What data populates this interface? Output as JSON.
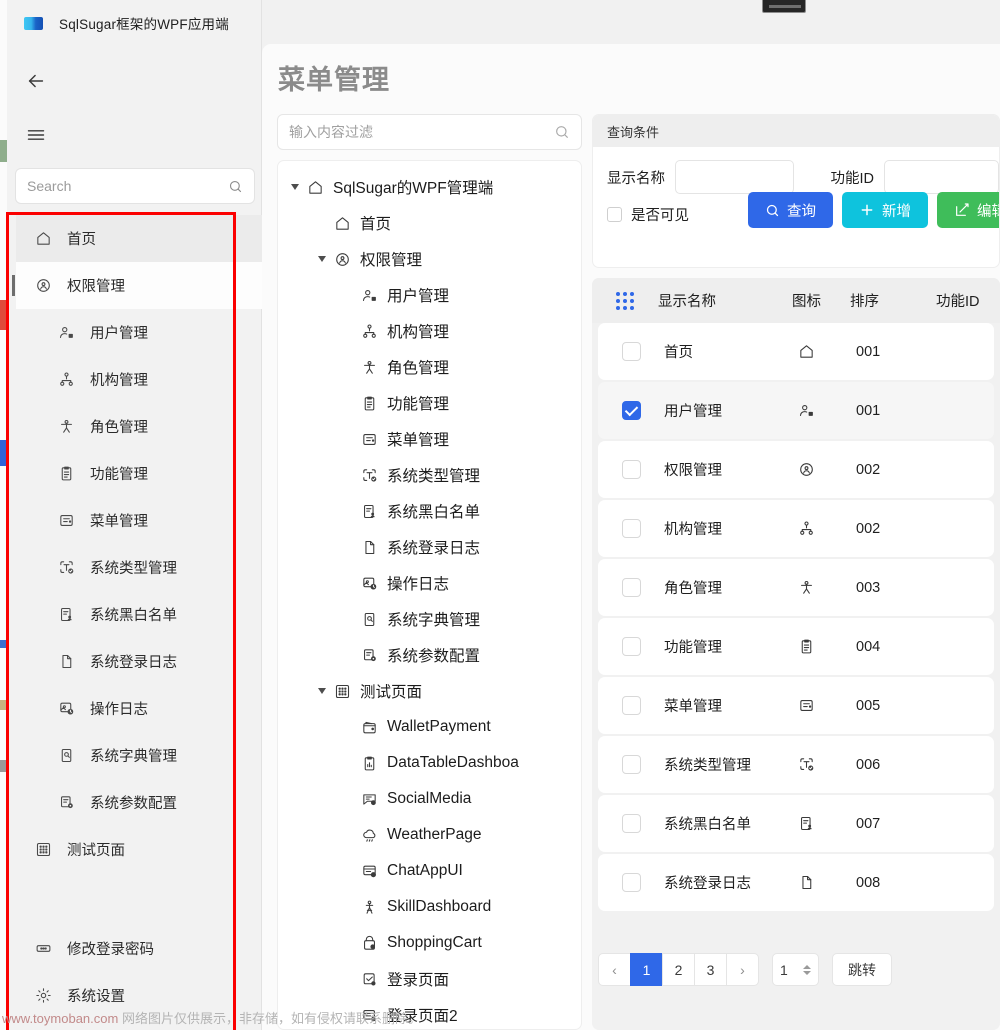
{
  "window": {
    "app_title": "SqlSugar框架的WPF应用端"
  },
  "sidebar": {
    "search_placeholder": "Search",
    "items": [
      {
        "label": "首页",
        "icon": "home-icon",
        "level": 1,
        "state": "hover"
      },
      {
        "label": "权限管理",
        "icon": "shield-user-icon",
        "level": 1,
        "state": "selected"
      },
      {
        "label": "用户管理",
        "icon": "user-settings-icon",
        "level": 2,
        "state": ""
      },
      {
        "label": "机构管理",
        "icon": "org-tree-icon",
        "level": 2,
        "state": ""
      },
      {
        "label": "角色管理",
        "icon": "role-person-icon",
        "level": 2,
        "state": ""
      },
      {
        "label": "功能管理",
        "icon": "clipboard-icon",
        "level": 2,
        "state": ""
      },
      {
        "label": "菜单管理",
        "icon": "menu-list-icon",
        "level": 2,
        "state": ""
      },
      {
        "label": "系统类型管理",
        "icon": "type-check-icon",
        "level": 2,
        "state": ""
      },
      {
        "label": "系统黑白名单",
        "icon": "list-user-icon",
        "level": 2,
        "state": ""
      },
      {
        "label": "系统登录日志",
        "icon": "file-icon",
        "level": 2,
        "state": ""
      },
      {
        "label": "操作日志",
        "icon": "log-clock-icon",
        "level": 2,
        "state": ""
      },
      {
        "label": "系统字典管理",
        "icon": "book-search-icon",
        "level": 2,
        "state": ""
      },
      {
        "label": "系统参数配置",
        "icon": "list-gear-icon",
        "level": 2,
        "state": ""
      },
      {
        "label": "测试页面",
        "icon": "grid-dots-icon",
        "level": 1,
        "state": ""
      }
    ],
    "bottom_items": [
      {
        "label": "修改登录密码",
        "icon": "password-icon"
      },
      {
        "label": "系统设置",
        "icon": "gear-icon"
      }
    ]
  },
  "page": {
    "title": "菜单管理"
  },
  "tree": {
    "filter_placeholder": "输入内容过滤",
    "nodes": [
      {
        "label": "SqlSugar的WPF管理端",
        "icon": "home-icon",
        "indent": 0,
        "expander": true
      },
      {
        "label": "首页",
        "icon": "home-icon",
        "indent": 1,
        "expander": false
      },
      {
        "label": "权限管理",
        "icon": "shield-user-icon",
        "indent": 1,
        "expander": true
      },
      {
        "label": "用户管理",
        "icon": "user-settings-icon",
        "indent": 2,
        "expander": false
      },
      {
        "label": "机构管理",
        "icon": "org-tree-icon",
        "indent": 2,
        "expander": false
      },
      {
        "label": "角色管理",
        "icon": "role-person-icon",
        "indent": 2,
        "expander": false
      },
      {
        "label": "功能管理",
        "icon": "clipboard-icon",
        "indent": 2,
        "expander": false
      },
      {
        "label": "菜单管理",
        "icon": "menu-list-icon",
        "indent": 2,
        "expander": false
      },
      {
        "label": "系统类型管理",
        "icon": "type-check-icon",
        "indent": 2,
        "expander": false
      },
      {
        "label": "系统黑白名单",
        "icon": "list-user-icon",
        "indent": 2,
        "expander": false
      },
      {
        "label": "系统登录日志",
        "icon": "file-icon",
        "indent": 2,
        "expander": false
      },
      {
        "label": "操作日志",
        "icon": "log-clock-icon",
        "indent": 2,
        "expander": false
      },
      {
        "label": "系统字典管理",
        "icon": "book-search-icon",
        "indent": 2,
        "expander": false
      },
      {
        "label": "系统参数配置",
        "icon": "list-gear-icon",
        "indent": 2,
        "expander": false
      },
      {
        "label": "测试页面",
        "icon": "grid-dots-icon",
        "indent": 1,
        "expander": true
      },
      {
        "label": "WalletPayment",
        "icon": "wallet-icon",
        "indent": 2,
        "expander": false
      },
      {
        "label": "DataTableDashboa",
        "icon": "chart-board-icon",
        "indent": 2,
        "expander": false
      },
      {
        "label": "SocialMedia",
        "icon": "chat-user-icon",
        "indent": 2,
        "expander": false
      },
      {
        "label": "WeatherPage",
        "icon": "cloud-rain-icon",
        "indent": 2,
        "expander": false
      },
      {
        "label": "ChatAppUI",
        "icon": "chat-window-icon",
        "indent": 2,
        "expander": false
      },
      {
        "label": "SkillDashboard",
        "icon": "skill-person-icon",
        "indent": 2,
        "expander": false
      },
      {
        "label": "ShoppingCart",
        "icon": "cart-icon",
        "indent": 2,
        "expander": false
      },
      {
        "label": "登录页面",
        "icon": "login-check-icon",
        "indent": 2,
        "expander": false
      },
      {
        "label": "登录页面2",
        "icon": "login-user-icon",
        "indent": 2,
        "expander": false
      }
    ]
  },
  "query": {
    "header": "查询条件",
    "name_label": "显示名称",
    "name_value": "",
    "fid_label": "功能ID",
    "fid_value": "",
    "visible_label": "是否可见",
    "visible_checked": false,
    "buttons": [
      {
        "label": "查询",
        "icon": "search-icon",
        "color": "#2f68e8"
      },
      {
        "label": "新增",
        "icon": "plus-icon",
        "color": "#0ec3dd"
      },
      {
        "label": "编辑",
        "icon": "edit-icon",
        "color": "#3fbd5a"
      }
    ]
  },
  "table": {
    "columns": [
      "",
      "显示名称",
      "图标",
      "排序",
      "功能ID"
    ],
    "rows": [
      {
        "checked": false,
        "name": "首页",
        "icon": "home-icon",
        "sort": "001",
        "fid": ""
      },
      {
        "checked": true,
        "name": "用户管理",
        "icon": "user-settings-icon",
        "sort": "001",
        "fid": ""
      },
      {
        "checked": false,
        "name": "权限管理",
        "icon": "shield-user-icon",
        "sort": "002",
        "fid": ""
      },
      {
        "checked": false,
        "name": "机构管理",
        "icon": "org-tree-icon",
        "sort": "002",
        "fid": ""
      },
      {
        "checked": false,
        "name": "角色管理",
        "icon": "role-person-icon",
        "sort": "003",
        "fid": ""
      },
      {
        "checked": false,
        "name": "功能管理",
        "icon": "clipboard-icon",
        "sort": "004",
        "fid": ""
      },
      {
        "checked": false,
        "name": "菜单管理",
        "icon": "menu-list-icon",
        "sort": "005",
        "fid": ""
      },
      {
        "checked": false,
        "name": "系统类型管理",
        "icon": "type-check-icon",
        "sort": "006",
        "fid": ""
      },
      {
        "checked": false,
        "name": "系统黑白名单",
        "icon": "list-user-icon",
        "sort": "007",
        "fid": ""
      },
      {
        "checked": false,
        "name": "系统登录日志",
        "icon": "file-icon",
        "sort": "008",
        "fid": ""
      }
    ]
  },
  "pager": {
    "prev": "‹",
    "pages": [
      "1",
      "2",
      "3"
    ],
    "active_page": "1",
    "next": "›",
    "goto_value": "1",
    "goto_label": "跳转"
  },
  "watermark": {
    "url": "www.toymoban.com",
    "text": " 网络图片仅供展示，非存储，如有侵权请联系删除。"
  }
}
